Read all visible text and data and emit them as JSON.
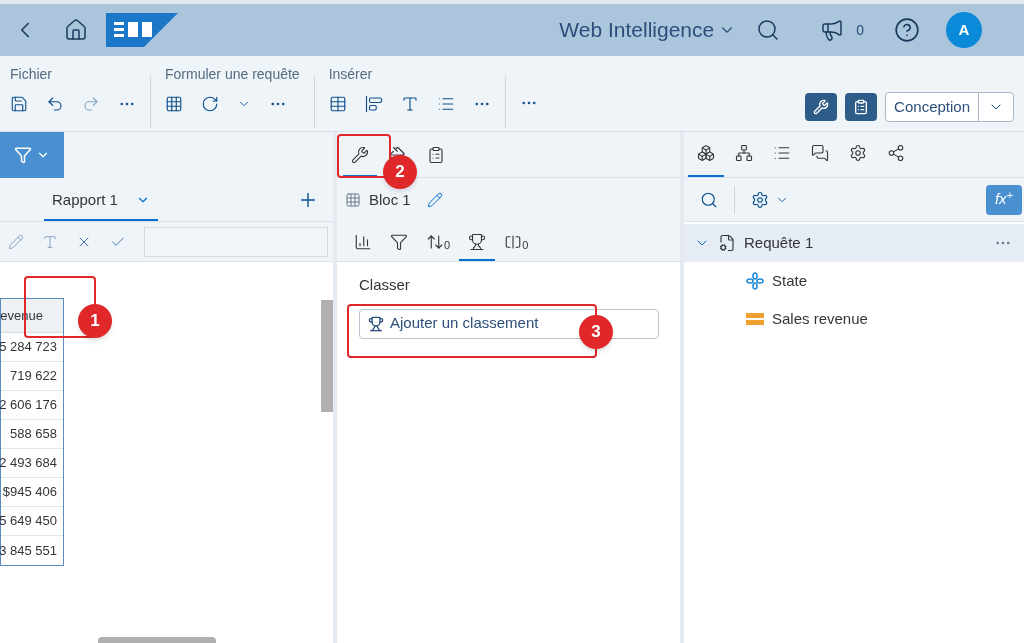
{
  "header": {
    "title": "Web Intelligence",
    "notification_count": "0",
    "avatar": "A"
  },
  "toolbar": {
    "groups": [
      {
        "label": "Fichier"
      },
      {
        "label": "Formuler une requête"
      },
      {
        "label": "Insérer"
      }
    ],
    "mode": "Conception"
  },
  "report": {
    "tabs": [
      {
        "label": "Rapport 1",
        "selected": true
      }
    ],
    "table": {
      "column": "evenue",
      "rows": [
        "5 284 723",
        "719 622",
        "2 606 176",
        "588 658",
        "2 493 684",
        "$945 406",
        "5 649 450",
        "3 845 551"
      ]
    }
  },
  "middle": {
    "tabs": [
      {
        "kind": "build",
        "selected": true
      },
      {
        "kind": "format",
        "selected": false
      },
      {
        "kind": "properties",
        "selected": false
      }
    ],
    "block": "Bloc 1",
    "subtabs": [
      {
        "kind": "data",
        "selected": false
      },
      {
        "kind": "filter",
        "selected": false
      },
      {
        "kind": "sort",
        "badge": "0",
        "selected": false
      },
      {
        "kind": "rank",
        "selected": true
      },
      {
        "kind": "break",
        "badge": "0",
        "selected": false
      }
    ],
    "section": "Classer",
    "add_button": "Ajouter un classement"
  },
  "right": {
    "tabs": [
      {
        "kind": "objects",
        "selected": true
      },
      {
        "kind": "structure",
        "selected": false
      },
      {
        "kind": "list",
        "selected": false
      },
      {
        "kind": "comments",
        "selected": false
      },
      {
        "kind": "settings",
        "selected": false
      },
      {
        "kind": "share",
        "selected": false
      }
    ],
    "formula_button": "fx$^{+}$",
    "tree": [
      {
        "label": "Requête 1",
        "expanded": true,
        "children": [
          {
            "label": "State",
            "kind": "dimension"
          },
          {
            "label": "Sales revenue",
            "kind": "measure"
          }
        ]
      }
    ]
  },
  "annotations": [
    {
      "number": "1"
    },
    {
      "number": "2"
    },
    {
      "number": "3"
    }
  ]
}
